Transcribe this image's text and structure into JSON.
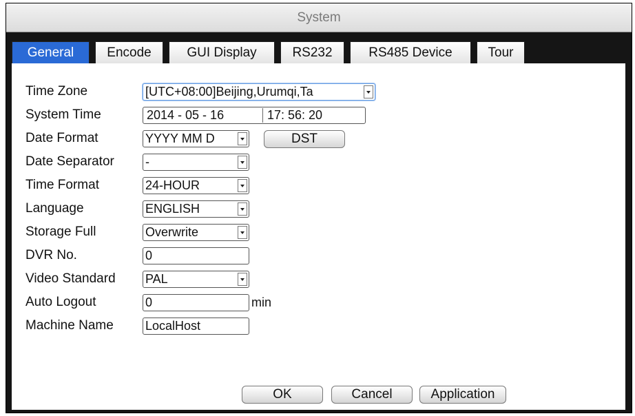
{
  "window": {
    "title": "System"
  },
  "tabs": [
    {
      "label": "General",
      "active": true
    },
    {
      "label": "Encode",
      "active": false
    },
    {
      "label": "GUI Display",
      "active": false
    },
    {
      "label": "RS232",
      "active": false
    },
    {
      "label": "RS485 Device",
      "active": false
    },
    {
      "label": "Tour",
      "active": false
    }
  ],
  "form": {
    "time_zone": {
      "label": "Time Zone",
      "value": "[UTC+08:00]Beijing,Urumqi,Ta"
    },
    "system_time": {
      "label": "System Time",
      "date": "2014 - 05 - 16",
      "time": "17: 56: 20"
    },
    "date_format": {
      "label": "Date Format",
      "value": "YYYY MM D"
    },
    "dst_button": "DST",
    "date_separator": {
      "label": "Date Separator",
      "value": "-"
    },
    "time_format": {
      "label": "Time Format",
      "value": "24-HOUR"
    },
    "language": {
      "label": "Language",
      "value": "ENGLISH"
    },
    "storage_full": {
      "label": "Storage Full",
      "value": "Overwrite"
    },
    "dvr_no": {
      "label": "DVR No.",
      "value": "0"
    },
    "video_standard": {
      "label": "Video Standard",
      "value": "PAL"
    },
    "auto_logout": {
      "label": "Auto Logout",
      "value": "0",
      "unit": "min"
    },
    "machine_name": {
      "label": "Machine Name",
      "value": "LocalHost"
    }
  },
  "buttons": {
    "ok": "OK",
    "cancel": "Cancel",
    "application": "Application"
  },
  "colors": {
    "active_tab": "#2a6ad6",
    "frame": "#151515",
    "title_text": "#7a7a7a"
  }
}
